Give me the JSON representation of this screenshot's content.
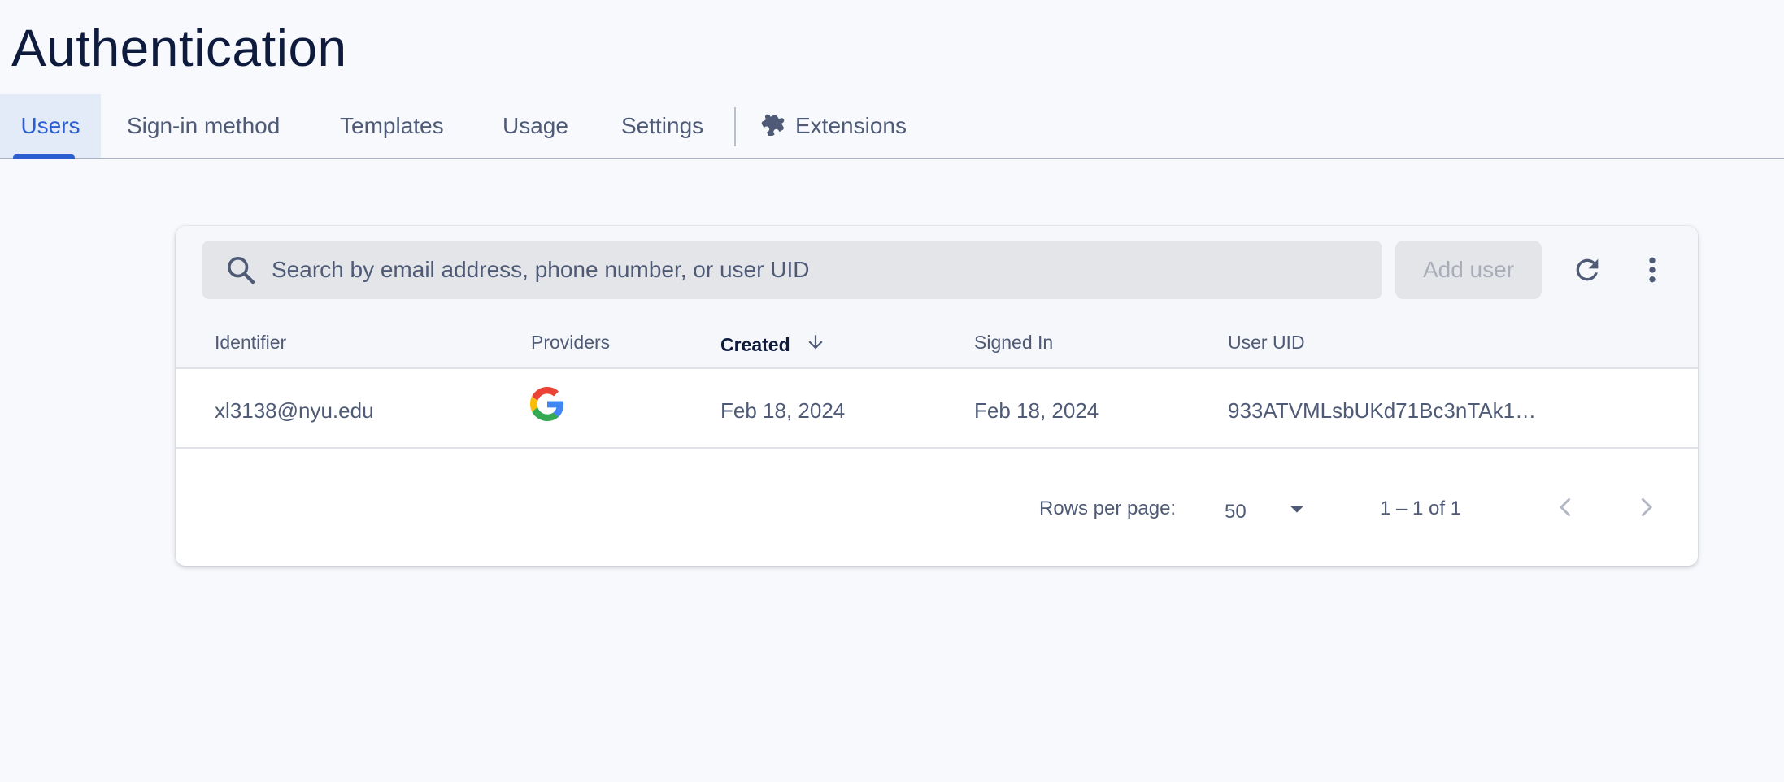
{
  "header": {
    "title": "Authentication"
  },
  "tabs": [
    {
      "label": "Users",
      "active": true
    },
    {
      "label": "Sign-in method"
    },
    {
      "label": "Templates"
    },
    {
      "label": "Usage"
    },
    {
      "label": "Settings"
    },
    {
      "label": "Extensions",
      "icon": "puzzle-icon"
    }
  ],
  "toolbar": {
    "search_placeholder": "Search by email address, phone number, or user UID",
    "add_user_label": "Add user",
    "refresh_icon": "refresh-icon",
    "more_icon": "more-vert-icon"
  },
  "table": {
    "columns": [
      "Identifier",
      "Providers",
      "Created",
      "Signed In",
      "User UID"
    ],
    "sorted_column": "Created",
    "sort_direction": "descending",
    "rows": [
      {
        "identifier": "xl3138@nyu.edu",
        "provider": "google-icon",
        "created": "Feb 18, 2024",
        "signed_in": "Feb 18, 2024",
        "uid": "933ATVMLsbUKd71Bc3nTAk1…"
      }
    ]
  },
  "pagination": {
    "rows_per_page_label": "Rows per page:",
    "rows_per_page": "50",
    "range": "1 – 1 of 1"
  },
  "colors": {
    "accent": "#2b5fcf",
    "title": "#0f1b3d",
    "background": "#f8f9fd"
  }
}
